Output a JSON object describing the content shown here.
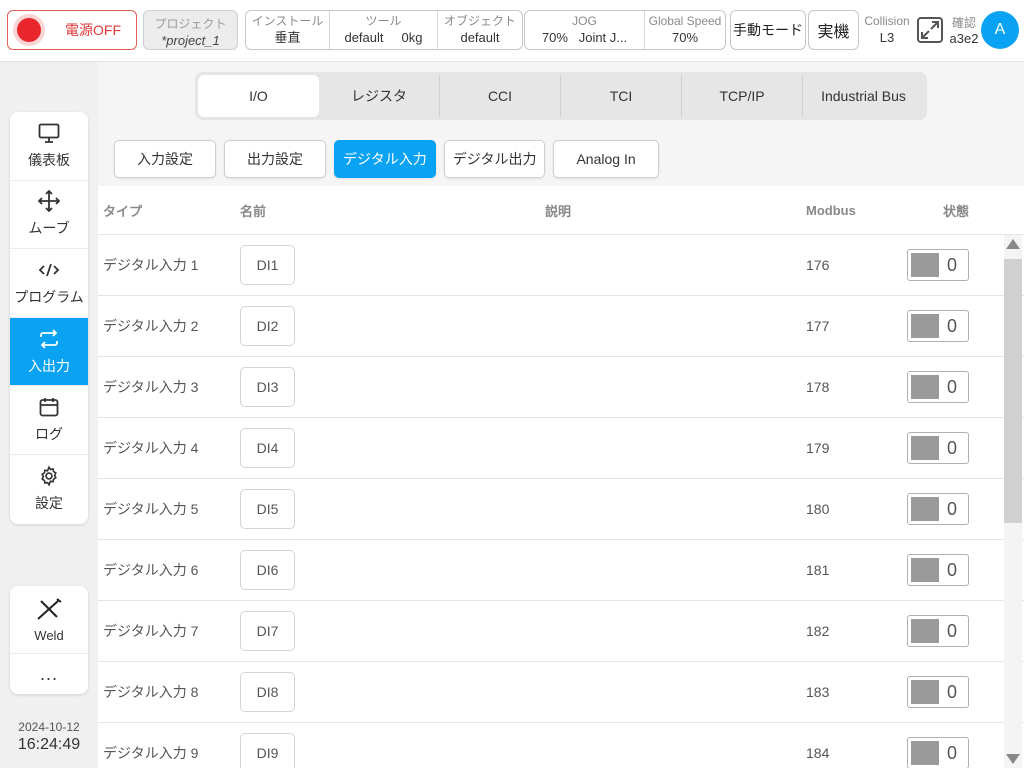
{
  "topbar": {
    "power_label": "電源OFF",
    "project": {
      "title": "プロジェクト",
      "value": "*project_1"
    },
    "install": {
      "title": "インストール",
      "value": "垂直"
    },
    "tool": {
      "title": "ツール",
      "value": "default     0kg"
    },
    "object": {
      "title": "オブジェクト",
      "value": "default"
    },
    "jog": {
      "title": "JOG",
      "value": "70%   Joint J..."
    },
    "speed": {
      "title": "Global Speed",
      "value": "70%"
    },
    "mode_label": "手動モード",
    "real_label": "実機",
    "collision": {
      "title": "Collision",
      "value": "L3"
    },
    "confirm": {
      "title": "確認",
      "value": "a3e2"
    },
    "avatar_letter": "A",
    "accent_color": "#0aa3f4"
  },
  "sidebar": {
    "items": [
      {
        "label": "儀表板",
        "icon": "monitor-icon",
        "active": false
      },
      {
        "label": "ムーブ",
        "icon": "move-icon",
        "active": false
      },
      {
        "label": "プログラム",
        "icon": "code-icon",
        "active": false
      },
      {
        "label": "入出力",
        "icon": "io-icon",
        "active": true
      },
      {
        "label": "ログ",
        "icon": "calendar-icon",
        "active": false
      },
      {
        "label": "設定",
        "icon": "gear-icon",
        "active": false
      }
    ],
    "weld_label": "Weld",
    "more_label": "..."
  },
  "clock": {
    "date": "2024-10-12",
    "time": "16:24:49"
  },
  "tabs": [
    "I/O",
    "レジスタ",
    "CCI",
    "TCI",
    "TCP/IP",
    "Industrial Bus"
  ],
  "active_tab": "I/O",
  "subtabs": [
    "入力設定",
    "出力設定",
    "デジタル入力",
    "デジタル出力",
    "Analog In"
  ],
  "active_subtab": "デジタル入力",
  "table": {
    "headers": {
      "type": "タイプ",
      "name": "名前",
      "desc": "説明",
      "modbus": "Modbus",
      "state": "状態"
    },
    "rows": [
      {
        "type": "デジタル入力 1",
        "name": "DI1",
        "desc": "",
        "modbus": "176",
        "state": "0"
      },
      {
        "type": "デジタル入力 2",
        "name": "DI2",
        "desc": "",
        "modbus": "177",
        "state": "0"
      },
      {
        "type": "デジタル入力 3",
        "name": "DI3",
        "desc": "",
        "modbus": "178",
        "state": "0"
      },
      {
        "type": "デジタル入力 4",
        "name": "DI4",
        "desc": "",
        "modbus": "179",
        "state": "0"
      },
      {
        "type": "デジタル入力 5",
        "name": "DI5",
        "desc": "",
        "modbus": "180",
        "state": "0"
      },
      {
        "type": "デジタル入力 6",
        "name": "DI6",
        "desc": "",
        "modbus": "181",
        "state": "0"
      },
      {
        "type": "デジタル入力 7",
        "name": "DI7",
        "desc": "",
        "modbus": "182",
        "state": "0"
      },
      {
        "type": "デジタル入力 8",
        "name": "DI8",
        "desc": "",
        "modbus": "183",
        "state": "0"
      },
      {
        "type": "デジタル入力 9",
        "name": "DI9",
        "desc": "",
        "modbus": "184",
        "state": "0"
      }
    ]
  }
}
